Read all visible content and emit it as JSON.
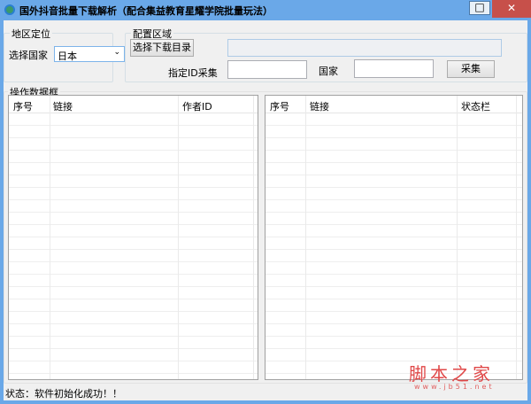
{
  "window": {
    "title": "国外抖音批量下载解析（配合集益教育星耀学院批量玩法）",
    "minimize": "–",
    "maximize": "□",
    "close": "✕"
  },
  "region": {
    "legend": "地区定位",
    "country_label": "选择国家",
    "country_value": "日本"
  },
  "config": {
    "legend": "配置区域",
    "choose_dir_button": "选择下载目录",
    "dir_value": "",
    "id_label": "指定ID采集",
    "id_value": "",
    "country_label": "国家",
    "country_value": "",
    "collect_button": "采集"
  },
  "data_frame": {
    "legend": "操作数据框",
    "left_columns": [
      "序号",
      "链接",
      "作者ID"
    ],
    "right_columns": [
      "序号",
      "链接",
      "状态栏"
    ]
  },
  "status": "状态：软件初始化成功！！",
  "watermark": {
    "text": "脚本之家",
    "url": "www.jb51.net"
  }
}
